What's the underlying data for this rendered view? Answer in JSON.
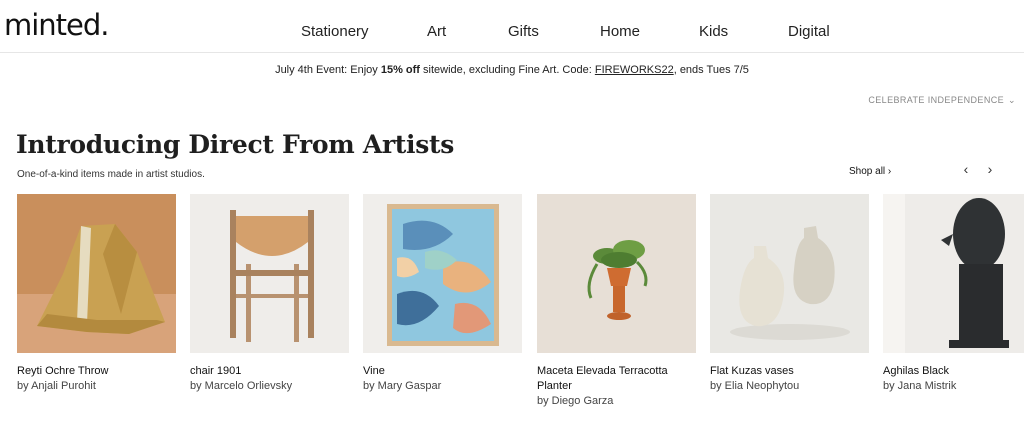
{
  "header": {
    "logo": "minted.",
    "nav": [
      "Stationery",
      "Art",
      "Gifts",
      "Home",
      "Kids",
      "Digital"
    ]
  },
  "promo": {
    "prefix": "July 4th Event: Enjoy ",
    "bold": "15% off",
    "middle": " sitewide, excluding Fine Art. Code: ",
    "code": "FIREWORKS22",
    "suffix": ", ends Tues 7/5"
  },
  "celebrate": {
    "label": "CELEBRATE INDEPENDENCE"
  },
  "section": {
    "title": "Introducing Direct From Artists",
    "subtitle": "One-of-a-kind items made in artist studios.",
    "shop_all": "Shop all ›"
  },
  "carousel": {
    "prev_icon": "‹",
    "next_icon": "›"
  },
  "products": [
    {
      "title": "Reyti Ochre Throw",
      "artist": "by Anjali Purohit"
    },
    {
      "title": "chair 1901",
      "artist": "by Marcelo Orlievsky"
    },
    {
      "title": "Vine",
      "artist": "by Mary Gaspar"
    },
    {
      "title": "Maceta Elevada Terracotta Planter",
      "artist": "by Diego Garza"
    },
    {
      "title": "Flat Kuzas vases",
      "artist": "by Elia Neophytou"
    },
    {
      "title": "Aghilas Black",
      "artist": "by Jana Mistrik"
    }
  ]
}
